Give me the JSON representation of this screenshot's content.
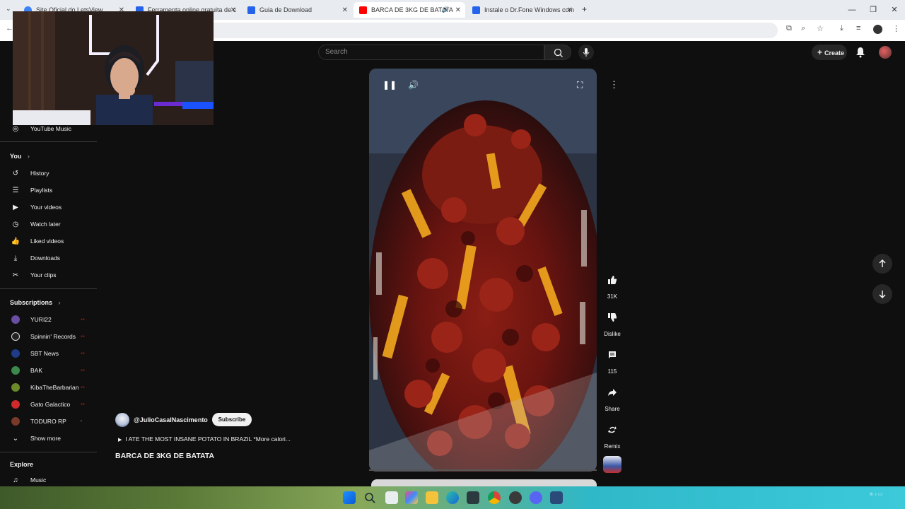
{
  "browser": {
    "tabs": [
      {
        "title": "Site Oficial do LetsView",
        "color": "#3b82f6"
      },
      {
        "title": "Ferramenta online gratuita de c",
        "color": "#2563eb"
      },
      {
        "title": "Guia de Download",
        "color": "#2563eb"
      },
      {
        "title": "BARCA DE 3KG DE BATATA",
        "color": "#ff0000"
      },
      {
        "title": "Instale o Dr.Fone Windows com",
        "color": "#2563eb"
      }
    ]
  },
  "youtube": {
    "search_placeholder": "Search",
    "create_label": "Create"
  },
  "sidebar": {
    "youtube_music": "YouTube Music",
    "you_header": "You",
    "you_items": [
      {
        "label": "History",
        "icon": "history-icon"
      },
      {
        "label": "Playlists",
        "icon": "playlists-icon"
      },
      {
        "label": "Your videos",
        "icon": "your-videos-icon"
      },
      {
        "label": "Watch later",
        "icon": "watch-later-icon"
      },
      {
        "label": "Liked videos",
        "icon": "liked-videos-icon"
      },
      {
        "label": "Downloads",
        "icon": "downloads-icon"
      },
      {
        "label": "Your clips",
        "icon": "clips-icon"
      }
    ],
    "subscriptions_header": "Subscriptions",
    "subscriptions": [
      {
        "name": "YURI22",
        "color": "#6a4ea3"
      },
      {
        "name": "Spinnin' Records",
        "color": "#222222"
      },
      {
        "name": "SBT News",
        "color": "#1f3c88"
      },
      {
        "name": "BAK",
        "color": "#3b8a4b"
      },
      {
        "name": "KibaTheBarbarian",
        "color": "#6d8a2a"
      },
      {
        "name": "Gato Galactico",
        "color": "#d02a2a"
      },
      {
        "name": "TODURO RP",
        "color": "#7a3a2a"
      }
    ],
    "show_more": "Show more",
    "explore_header": "Explore",
    "explore_items": [
      {
        "label": "Music",
        "icon": "music-icon"
      }
    ]
  },
  "short": {
    "channel_handle": "@JulioCasalNascimento",
    "subscribe_label": "Subscribe",
    "description": "I ATE THE MOST INSANE POTATO IN BRAZIL *More calori...",
    "title": "BARCA DE 3KG DE BATATA",
    "likes": "31K",
    "dislike_label": "Dislike",
    "comments": "115",
    "share_label": "Share",
    "remix_label": "Remix"
  }
}
